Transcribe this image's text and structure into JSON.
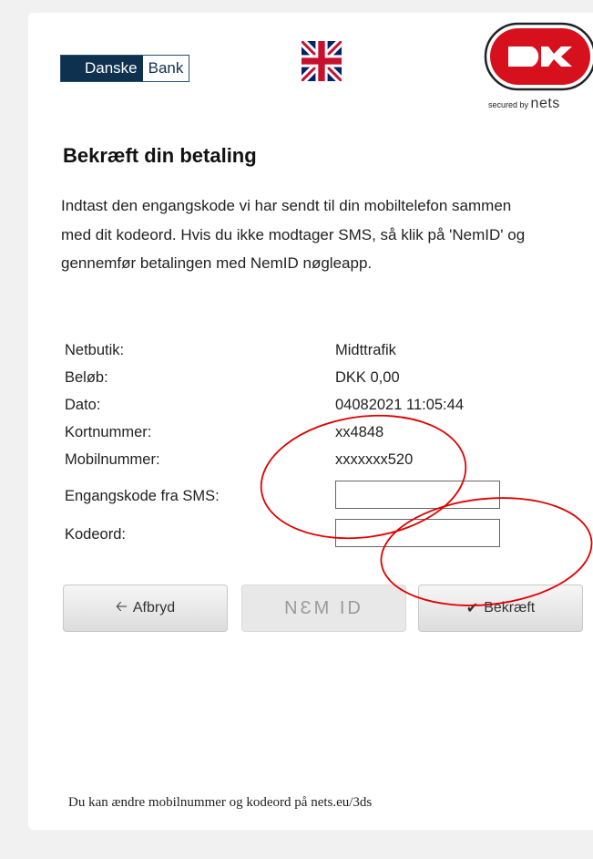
{
  "header": {
    "bank_name_part1": "Danske",
    "bank_name_part2": "Bank",
    "language_flag": "uk-flag-icon",
    "brand_logo": "dankort-logo",
    "secured_by": "secured by",
    "nets_label": "nets"
  },
  "title": "Bekræft din betaling",
  "intro": "Indtast den engangskode vi har sendt til din mobiltelefon sammen med dit kodeord. Hvis du ikke modtager SMS, så klik på 'NemID' og gennemfør betalingen med NemID nøgleapp.",
  "details": [
    {
      "label": "Netbutik:",
      "value": "Midttrafik"
    },
    {
      "label": "Beløb:",
      "value": "DKK 0,00"
    },
    {
      "label": "Dato:",
      "value": "04082021 11:05:44"
    },
    {
      "label": "Kortnummer:",
      "value": "xx4848"
    },
    {
      "label": "Mobilnummer:",
      "value": "xxxxxxx520"
    }
  ],
  "form": {
    "sms_label": "Engangskode fra SMS:",
    "sms_value": "",
    "password_label": "Kodeord:",
    "password_value": ""
  },
  "buttons": {
    "cancel": "Afbryd",
    "cancel_icon": "arrow-left-icon",
    "nemid": "NƐM ID",
    "confirm": "Bekræft",
    "confirm_icon": "checkmark-icon"
  },
  "footer": "Du kan ændre mobilnummer og kodeord på nets.eu/3ds",
  "colors": {
    "annotation": "#e00000",
    "danske_navy": "#0e3150",
    "dankort_red": "#d7101d"
  }
}
